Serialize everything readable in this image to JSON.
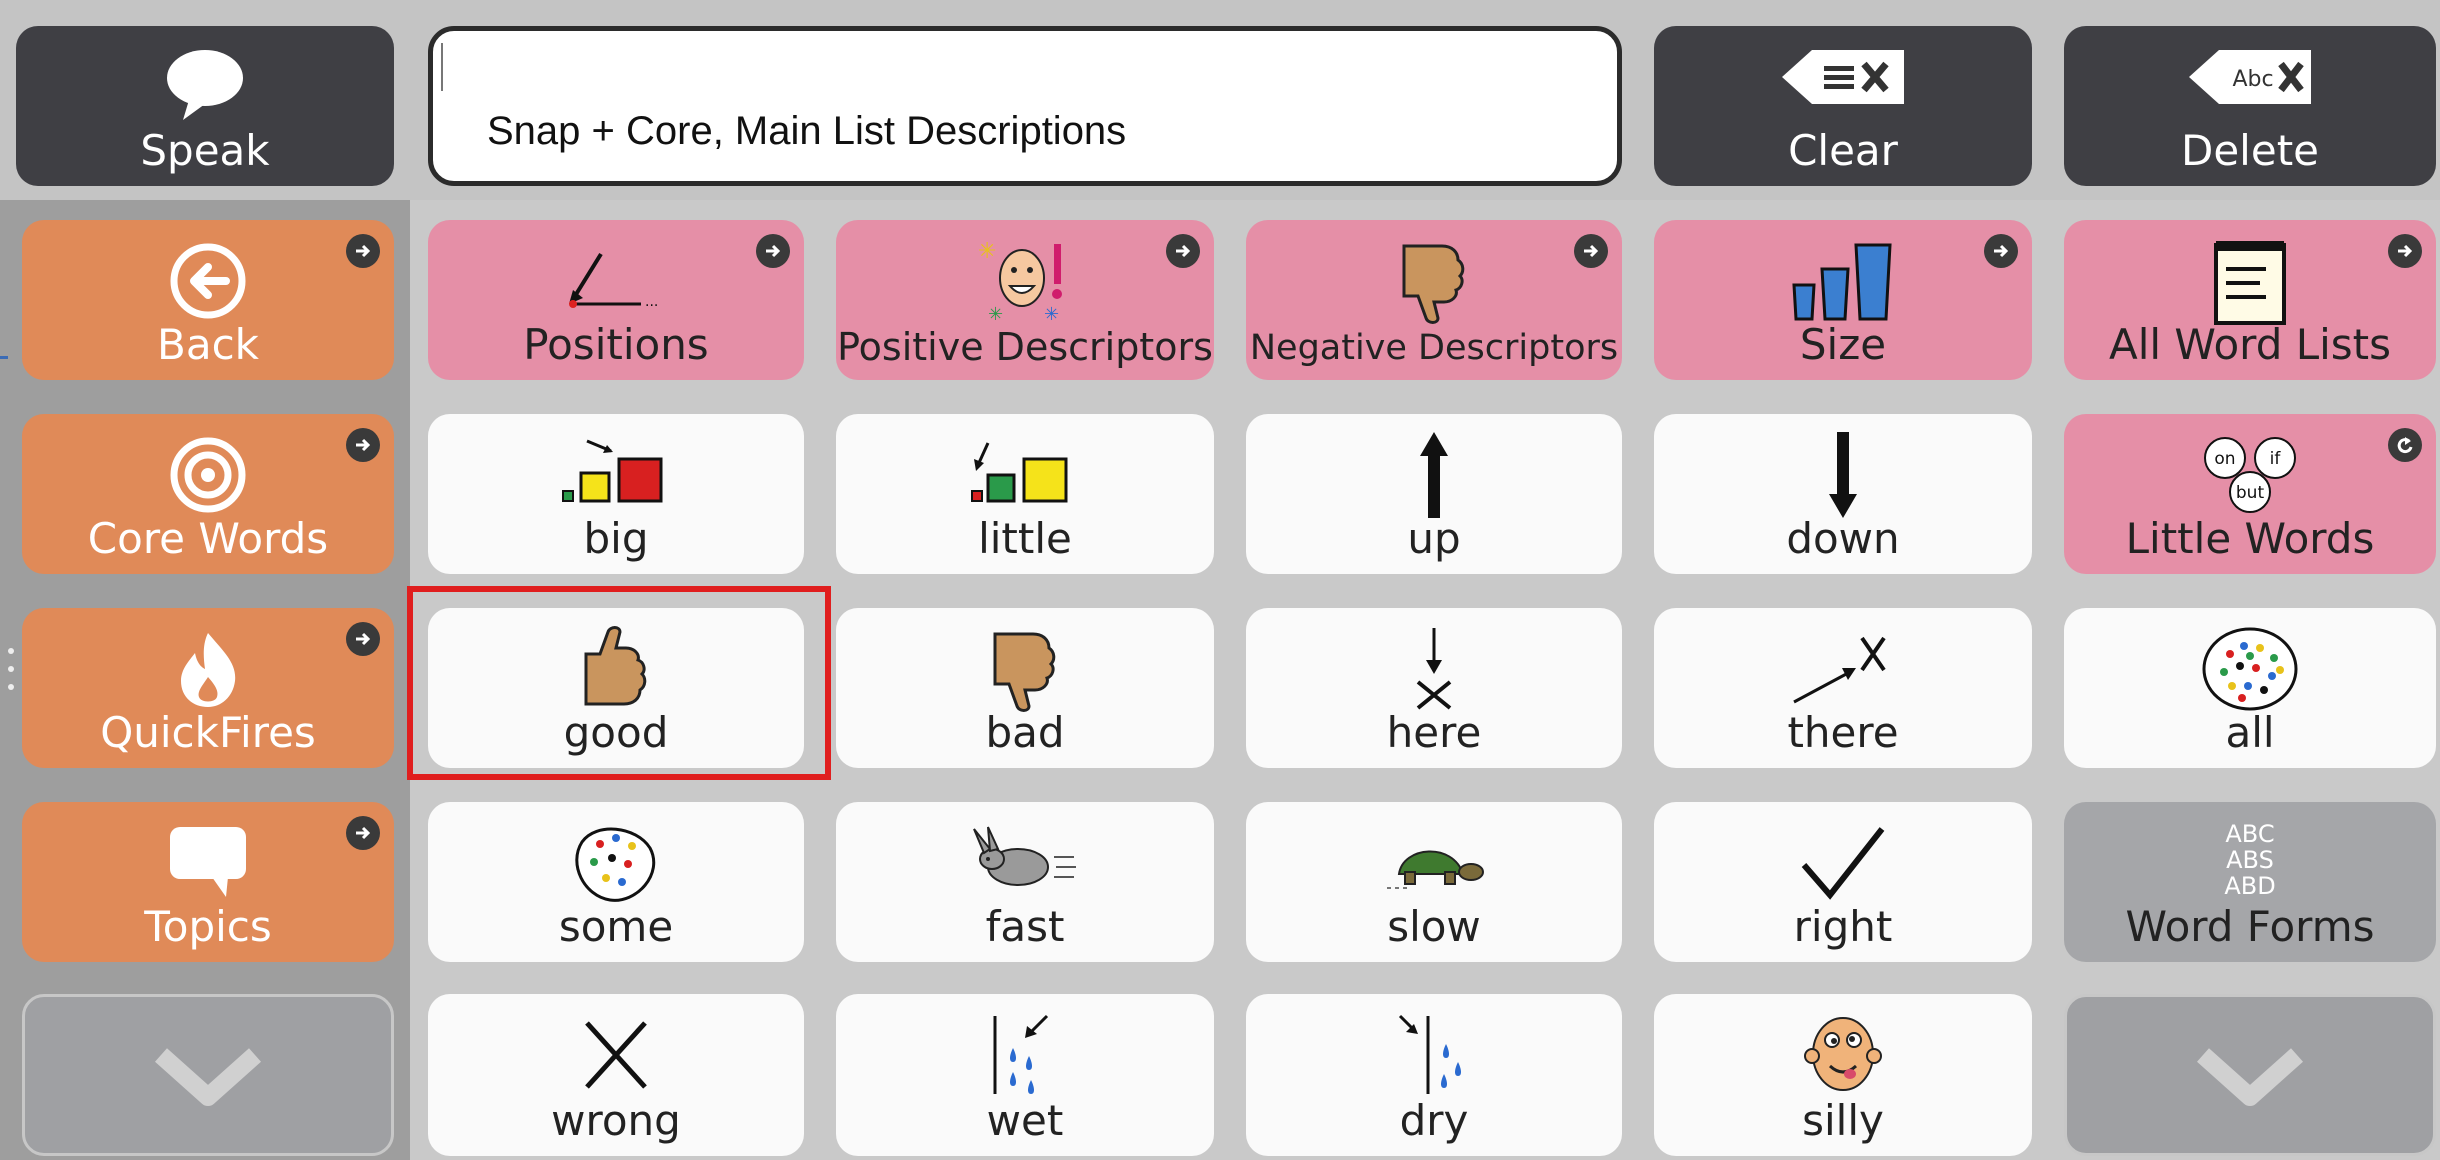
{
  "colors": {
    "speak_bar": "#3f3f44",
    "navigation": "#e08a58",
    "category": "#e58fa7",
    "word": "#fafafa",
    "word_forms": "#a5a6a9",
    "highlight": "#e01e1e"
  },
  "speak": {
    "label": "Speak",
    "icon": "speech-bubble-icon"
  },
  "message_window": {
    "text": "Snap + Core, Main List Descriptions"
  },
  "clear": {
    "label": "Clear",
    "icon": "clear-line-icon"
  },
  "delete": {
    "label": "Delete",
    "icon": "delete-word-icon",
    "icon_text": "Abc"
  },
  "nav": {
    "back": {
      "label": "Back",
      "icon": "back-circle-icon"
    },
    "core_words": {
      "label": "Core Words",
      "icon": "target-icon"
    },
    "quickfires": {
      "label": "QuickFires",
      "icon": "fire-icon"
    },
    "topics": {
      "label": "Topics",
      "icon": "chat-bubble-icon"
    },
    "scroll_down": {
      "icon": "chevron-down-icon"
    }
  },
  "categories": {
    "positions": {
      "label": "Positions",
      "icon": "position-arrow-icon"
    },
    "positive": {
      "label": "Positive Descriptors",
      "icon": "happy-face-icon"
    },
    "negative": {
      "label": "Negative Descriptors",
      "icon": "thumbs-down-icon"
    },
    "size": {
      "label": "Size",
      "icon": "cups-size-icon"
    },
    "all_lists": {
      "label": "All Word Lists",
      "icon": "notepad-icon"
    }
  },
  "little_words": {
    "label": "Little Words",
    "icon": "little-words-icon",
    "bubbles": [
      "on",
      "if",
      "but"
    ]
  },
  "word_forms": {
    "label": "Word Forms",
    "icon": "abc-forms-icon",
    "icon_lines": [
      "ABC",
      "ABS",
      "ABD"
    ]
  },
  "words": {
    "big": {
      "label": "big",
      "icon": "big-squares-icon"
    },
    "little": {
      "label": "little",
      "icon": "little-squares-icon"
    },
    "up": {
      "label": "up",
      "icon": "arrow-up-icon"
    },
    "down": {
      "label": "down",
      "icon": "arrow-down-icon"
    },
    "good": {
      "label": "good",
      "icon": "thumbs-up-icon"
    },
    "bad": {
      "label": "bad",
      "icon": "thumbs-down-icon"
    },
    "here": {
      "label": "here",
      "icon": "here-arrow-icon"
    },
    "there": {
      "label": "there",
      "icon": "there-arrow-icon"
    },
    "all": {
      "label": "all",
      "icon": "all-dots-icon"
    },
    "some": {
      "label": "some",
      "icon": "some-dots-icon"
    },
    "fast": {
      "label": "fast",
      "icon": "rabbit-icon"
    },
    "slow": {
      "label": "slow",
      "icon": "turtle-icon"
    },
    "right": {
      "label": "right",
      "icon": "check-mark-icon"
    },
    "wrong": {
      "label": "wrong",
      "icon": "x-mark-icon"
    },
    "wet": {
      "label": "wet",
      "icon": "water-drops-icon"
    },
    "dry": {
      "label": "dry",
      "icon": "drying-drops-icon"
    },
    "silly": {
      "label": "silly",
      "icon": "silly-face-icon"
    }
  }
}
